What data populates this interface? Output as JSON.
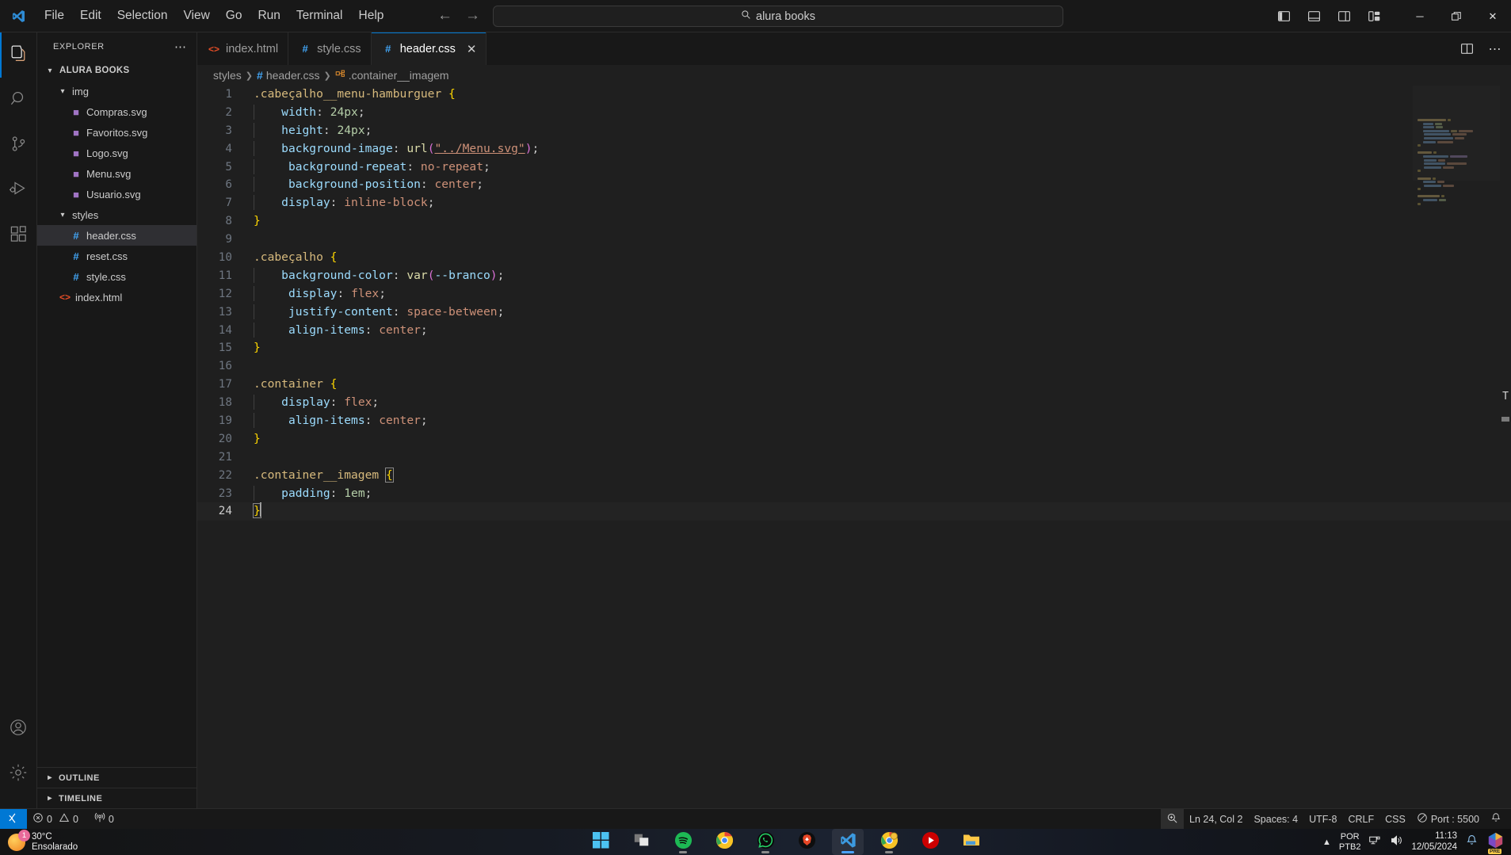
{
  "titlebar": {
    "logo_icon": "vscode-logo-icon",
    "menus": [
      "File",
      "Edit",
      "Selection",
      "View",
      "Go",
      "Run",
      "Terminal",
      "Help"
    ],
    "back_icon": "arrow-left-icon",
    "forward_icon": "arrow-right-icon",
    "quick_input": {
      "icon": "search-icon",
      "value": "alura books"
    },
    "layout_buttons": [
      {
        "name": "toggle-primary-sidebar",
        "icon": "panel-left-icon"
      },
      {
        "name": "toggle-panel",
        "icon": "panel-bottom-icon"
      },
      {
        "name": "toggle-secondary-sidebar",
        "icon": "panel-right-icon"
      },
      {
        "name": "customize-layout",
        "icon": "layout-grid-icon"
      }
    ],
    "window_buttons": [
      {
        "name": "minimize-button",
        "glyph": "─"
      },
      {
        "name": "restore-button",
        "glyph": "❐"
      },
      {
        "name": "close-button",
        "glyph": "✕"
      }
    ]
  },
  "activitybar": {
    "items": [
      {
        "name": "explorer",
        "icon": "files-icon",
        "active": true
      },
      {
        "name": "search",
        "icon": "search-icon",
        "active": false
      },
      {
        "name": "source-control",
        "icon": "source-control-icon",
        "active": false
      },
      {
        "name": "run-and-debug",
        "icon": "run-debug-icon",
        "active": false
      },
      {
        "name": "extensions",
        "icon": "extensions-icon",
        "active": false
      }
    ],
    "bottom": [
      {
        "name": "accounts",
        "icon": "account-icon"
      },
      {
        "name": "manage-settings",
        "icon": "gear-icon"
      }
    ]
  },
  "sidebar": {
    "title": "EXPLORER",
    "more_actions_icon": "ellipsis-icon",
    "root": {
      "label": "ALURA BOOKS",
      "expanded": true
    },
    "tree": [
      {
        "label": "img",
        "type": "folder",
        "indent": 2,
        "expanded": true
      },
      {
        "label": "Compras.svg",
        "type": "svg",
        "indent": 3
      },
      {
        "label": "Favoritos.svg",
        "type": "svg",
        "indent": 3
      },
      {
        "label": "Logo.svg",
        "type": "svg",
        "indent": 3
      },
      {
        "label": "Menu.svg",
        "type": "svg",
        "indent": 3
      },
      {
        "label": "Usuario.svg",
        "type": "svg",
        "indent": 3
      },
      {
        "label": "styles",
        "type": "folder",
        "indent": 2,
        "expanded": true
      },
      {
        "label": "header.css",
        "type": "css",
        "indent": 3,
        "selected": true
      },
      {
        "label": "reset.css",
        "type": "css",
        "indent": 3
      },
      {
        "label": "style.css",
        "type": "css",
        "indent": 3
      },
      {
        "label": "index.html",
        "type": "html",
        "indent": 2
      }
    ],
    "sections": [
      {
        "label": "OUTLINE",
        "expanded": false
      },
      {
        "label": "TIMELINE",
        "expanded": false
      }
    ]
  },
  "editor": {
    "tabs": [
      {
        "label": "index.html",
        "icon": "html-file-icon",
        "active": false,
        "closable": false
      },
      {
        "label": "style.css",
        "icon": "css-file-icon",
        "active": false,
        "closable": false
      },
      {
        "label": "header.css",
        "icon": "css-file-icon",
        "active": true,
        "closable": true,
        "close_glyph": "✕"
      }
    ],
    "tab_actions": [
      {
        "name": "split-editor-right",
        "icon": "split-editor-icon"
      },
      {
        "name": "more-editor-actions",
        "icon": "ellipsis-icon"
      }
    ],
    "breadcrumbs": [
      {
        "label": "styles",
        "icon": null
      },
      {
        "label": "header.css",
        "icon": "css-file-icon"
      },
      {
        "label": ".container__imagem",
        "icon": "css-symbol-icon"
      }
    ],
    "lines": [
      {
        "n": 1,
        "text": ".cabeçalho__menu-hamburguer {"
      },
      {
        "n": 2,
        "text": "    width: 24px;"
      },
      {
        "n": 3,
        "text": "    height: 24px;"
      },
      {
        "n": 4,
        "text": "    background-image: url(\"../Menu.svg\");"
      },
      {
        "n": 5,
        "text": "     background-repeat: no-repeat;"
      },
      {
        "n": 6,
        "text": "     background-position: center;"
      },
      {
        "n": 7,
        "text": "    display: inline-block;"
      },
      {
        "n": 8,
        "text": "}"
      },
      {
        "n": 9,
        "text": ""
      },
      {
        "n": 10,
        "text": ".cabeçalho {"
      },
      {
        "n": 11,
        "text": "    background-color: var(--branco);"
      },
      {
        "n": 12,
        "text": "     display: flex;"
      },
      {
        "n": 13,
        "text": "     justify-content: space-between;"
      },
      {
        "n": 14,
        "text": "     align-items: center;"
      },
      {
        "n": 15,
        "text": "}"
      },
      {
        "n": 16,
        "text": ""
      },
      {
        "n": 17,
        "text": ".container {"
      },
      {
        "n": 18,
        "text": "    display: flex;"
      },
      {
        "n": 19,
        "text": "     align-items: center;"
      },
      {
        "n": 20,
        "text": "}"
      },
      {
        "n": 21,
        "text": ""
      },
      {
        "n": 22,
        "text": ".container__imagem {"
      },
      {
        "n": 23,
        "text": "    padding: 1em;"
      },
      {
        "n": 24,
        "text": "}"
      }
    ],
    "current_line": 24
  },
  "statusbar": {
    "remote_icon": "remote-window-icon",
    "left": [
      {
        "name": "errors-warnings",
        "text": "0  0",
        "errors": "0",
        "warnings": "0",
        "error_icon": "error-circle-icon",
        "warning_icon": "warning-triangle-icon"
      },
      {
        "name": "ports",
        "text": "0",
        "icon": "radio-tower-icon"
      }
    ],
    "right": [
      {
        "name": "screencast-zoom",
        "icon": "zoom-icon",
        "text": ""
      },
      {
        "name": "editor-position",
        "text": "Ln 24, Col 2"
      },
      {
        "name": "editor-indentation",
        "text": "Spaces: 4"
      },
      {
        "name": "editor-encoding",
        "text": "UTF-8"
      },
      {
        "name": "editor-eol",
        "text": "CRLF"
      },
      {
        "name": "editor-language",
        "text": "CSS"
      },
      {
        "name": "live-server-port",
        "text": "Port : 5500",
        "icon": "circle-slash-icon"
      },
      {
        "name": "notifications",
        "icon": "bell-icon",
        "text": ""
      }
    ]
  },
  "taskbar": {
    "weather": {
      "temperature": "30°C",
      "condition": "Ensolarado",
      "badge": "1"
    },
    "apps": [
      {
        "name": "start-button",
        "icon": "windows-logo-icon"
      },
      {
        "name": "task-view",
        "icon": "task-view-icon"
      },
      {
        "name": "spotify",
        "icon": "spotify-icon",
        "running": true
      },
      {
        "name": "google-chrome",
        "icon": "chrome-icon",
        "running": true
      },
      {
        "name": "whatsapp",
        "icon": "whatsapp-icon",
        "running": true
      },
      {
        "name": "brave",
        "icon": "brave-icon",
        "running": false
      },
      {
        "name": "visual-studio-code",
        "icon": "vscode-icon",
        "running": true,
        "active": true
      },
      {
        "name": "chrome-window",
        "icon": "chrome-icon",
        "running": true
      },
      {
        "name": "youtube-music",
        "icon": "youtube-music-icon",
        "running": false
      },
      {
        "name": "file-explorer",
        "icon": "folder-icon",
        "running": false
      }
    ],
    "tray": {
      "chevron_icon": "chevron-up-icon",
      "language": "POR",
      "keyboard": "PTB2",
      "network_icon": "network-icon",
      "volume_icon": "speaker-icon",
      "time": "11:13",
      "date": "12/05/2024",
      "notification_icon": "bell-icon",
      "copilot_icon": "copilot-icon",
      "copilot_badge": "PRE"
    }
  },
  "colors": {
    "accent": "#0078d4",
    "editor_bg": "#1f1f1f",
    "chrome_bg": "#181818",
    "selector": "#d7ba7d",
    "property": "#9cdcfe",
    "value": "#ce9178",
    "number": "#b5cea8",
    "brace": "#ffd700"
  }
}
